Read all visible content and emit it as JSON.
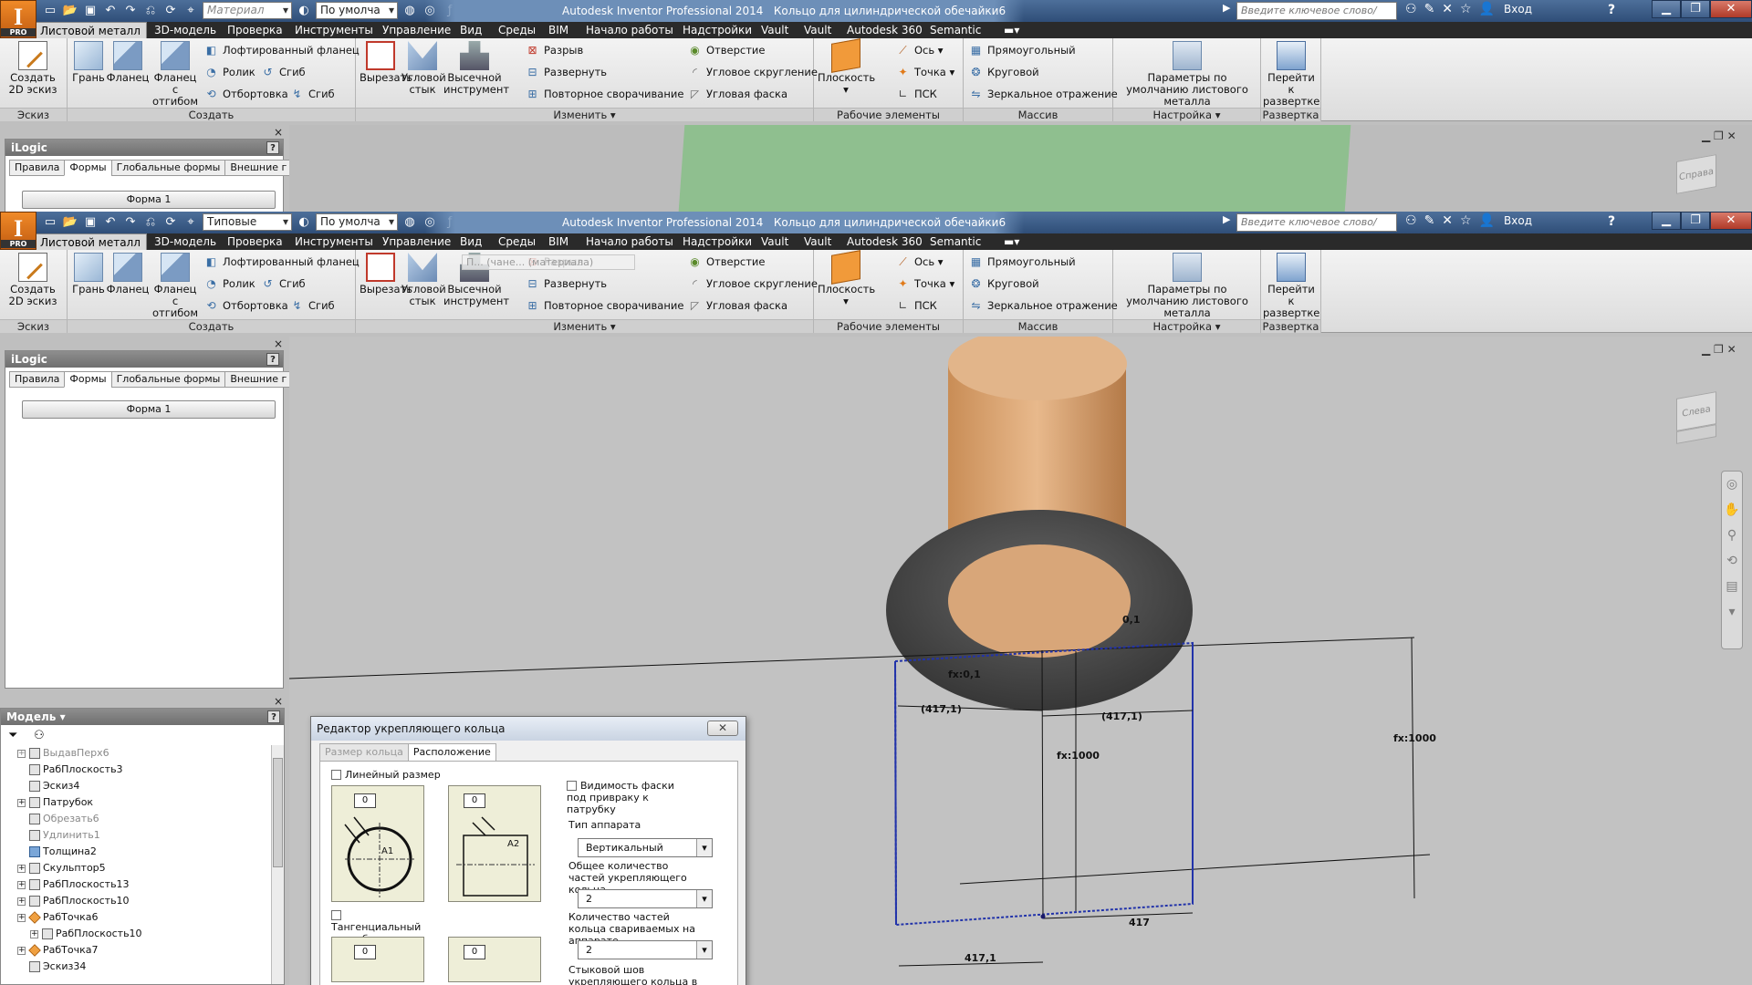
{
  "app": {
    "title": "Autodesk Inventor Professional 2014",
    "document": "Кольцо для цилиндрической обечайки6",
    "logo_letter": "I",
    "logo_badge": "PRO"
  },
  "qat_back": {
    "material": "Материал",
    "appearance": "По умолча"
  },
  "qat_front": {
    "material": "Типовые",
    "appearance": "По умолча"
  },
  "search": {
    "placeholder": "Введите ключевое слово/фразу"
  },
  "signin": "Вход",
  "help": "?",
  "tabs": [
    "Листовой металл",
    "3D-модель",
    "Проверка",
    "Инструменты",
    "Управление",
    "Вид",
    "Среды",
    "BIM",
    "Начало работы",
    "Надстройки",
    "Vault",
    "Autodesk 360",
    "Semantic"
  ],
  "ribbon": {
    "create_sketch": "Создать 2D эскиз",
    "face": "Грань",
    "flange": "Фланец",
    "flange_bend": "Фланец с отгибом",
    "loft_flange": "Лофтированный фланец",
    "roll": "Ролик",
    "bend1": "Сгиб",
    "hem": "Отбортовка",
    "bend2": "Сгиб",
    "cut": "Вырезать",
    "corner_seam": "Угловой стык",
    "punch": "Высечной инструмент",
    "rip": "Разрыв",
    "unfold": "Развернуть",
    "refold": "Повторное сворачивание",
    "hole": "Отверстие",
    "corner_round": "Угловое скругление",
    "corner_chamfer": "Угловая фаска",
    "plane": "Плоскость",
    "axis": "Ось",
    "point": "Точка",
    "ucs": "ПСК",
    "rect": "Прямоугольный",
    "circ": "Круговой",
    "mirror": "Зеркальное отражение",
    "defaults": "Параметры по умолчанию листового металла",
    "go_flat": "Перейти к развертке",
    "groups": {
      "sketch": "Эскиз",
      "create": "Создать",
      "modify": "Изменить",
      "work": "Рабочие элементы",
      "pattern": "Массив",
      "setup": "Настройка",
      "flat": "Развертка"
    }
  },
  "ilogic": {
    "title": "iLogic",
    "tabs": [
      "Правила",
      "Формы",
      "Глобальные формы",
      "Внешние г"
    ],
    "form_button": "Форма 1"
  },
  "model": {
    "title": "Модель ▾",
    "items": [
      {
        "label": "ВыдавПерх6",
        "dim": true,
        "exp": true,
        "indent": 0,
        "icon": "grey"
      },
      {
        "label": "РабПлоскость3",
        "dim": false,
        "exp": false,
        "indent": 0,
        "icon": "grey"
      },
      {
        "label": "Эскиз4",
        "dim": false,
        "exp": false,
        "indent": 0,
        "icon": "grey"
      },
      {
        "label": "Патрубок",
        "dim": false,
        "exp": true,
        "indent": 0,
        "icon": "grey"
      },
      {
        "label": "Обрезать6",
        "dim": true,
        "exp": false,
        "indent": 0,
        "icon": "grey"
      },
      {
        "label": "Удлинить1",
        "dim": true,
        "exp": false,
        "indent": 0,
        "icon": "grey"
      },
      {
        "label": "Толщина2",
        "dim": false,
        "exp": false,
        "indent": 0,
        "icon": "blue"
      },
      {
        "label": "Скульптор5",
        "dim": false,
        "exp": true,
        "indent": 0,
        "icon": "grey"
      },
      {
        "label": "РабПлоскость13",
        "dim": false,
        "exp": true,
        "indent": 0,
        "icon": "grey"
      },
      {
        "label": "РабПлоскость10",
        "dim": false,
        "exp": true,
        "indent": 0,
        "icon": "grey"
      },
      {
        "label": "РабТочка6",
        "dim": false,
        "exp": true,
        "indent": 0,
        "icon": "orange"
      },
      {
        "label": "РабПлоскость10",
        "dim": false,
        "exp": true,
        "indent": 1,
        "icon": "grey"
      },
      {
        "label": "РабТочка7",
        "dim": false,
        "exp": true,
        "indent": 0,
        "icon": "orange"
      },
      {
        "label": "Эскиз34",
        "dim": false,
        "exp": false,
        "indent": 0,
        "icon": "grey"
      }
    ]
  },
  "viewcube_back": "Справа",
  "viewcube_front": "Слева",
  "tooltip_ghost": "П... (чане... (материала)",
  "dims": {
    "d1": "0,1",
    "d2": "fx:0,1",
    "d3": "(417,1)",
    "d4": "(417,1)",
    "d5": "fx:1000",
    "d6": "fx:1000",
    "d7": "417",
    "d8": "417,1"
  },
  "dialog": {
    "title": "Редактор укрепляющего кольца",
    "tabs": [
      "Размер кольца",
      "Расположение"
    ],
    "linear": "Линейный размер",
    "tangential": "Тангенциальный патрубок",
    "chamfer_vis": "Видимость фаски под привраку к патрубку",
    "apparatus_type_label": "Тип аппарата",
    "apparatus_type": "Вертикальный",
    "parts_total_label": "Общее количество частей укрепляющего кольца",
    "parts_total": "2",
    "parts_welded_label": "Количество частей кольца свариваемых на аппарате",
    "parts_welded": "2",
    "butt_weld_label": "Стыковой шов укрепляющего кольца в карте",
    "pic_val": "0",
    "a1": "A1",
    "a2": "A2"
  }
}
